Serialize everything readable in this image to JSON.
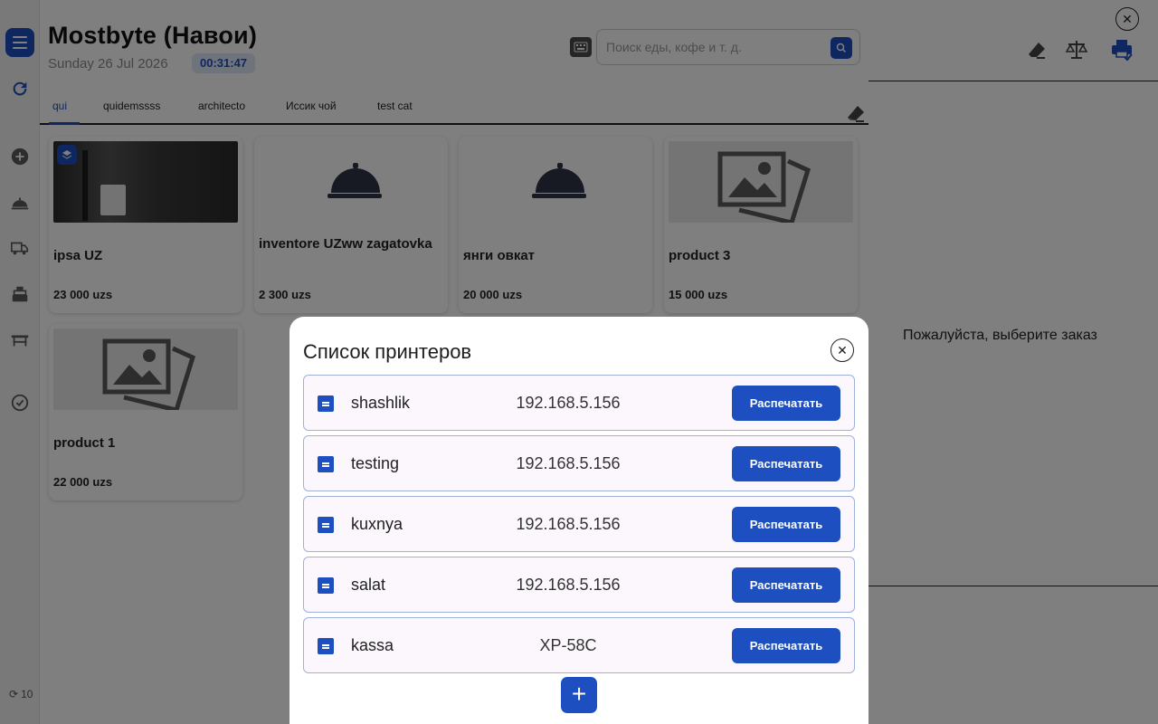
{
  "header": {
    "title": "Mostbyte (Навои)",
    "date": "Sunday 26 Jul 2026",
    "time": "00:31:47",
    "search_placeholder": "Поиск еды, кофе и т. д."
  },
  "tabs": [
    {
      "label": "qui",
      "active": true
    },
    {
      "label": "quidemssss"
    },
    {
      "label": "architecto"
    },
    {
      "label": "Иссик чой"
    },
    {
      "label": "test cat"
    }
  ],
  "products": [
    {
      "name": "ipsa UZ",
      "price": "23 000 uzs",
      "image": "photo"
    },
    {
      "name": "inventore UZww zagatovka",
      "price": "2 300 uzs",
      "image": "cloche-icon"
    },
    {
      "name": "янги овкат",
      "price": "20 000 uzs",
      "image": "cloche-icon"
    },
    {
      "name": "product 3",
      "price": "15 000 uzs",
      "image": "image-placeholder-icon"
    },
    {
      "name": "product 1",
      "price": "22 000 uzs",
      "image": "image-placeholder-icon"
    }
  ],
  "sidebar": {
    "icons": [
      "menu-icon",
      "refresh-icon",
      "add-icon",
      "cloche-icon",
      "truck-icon",
      "cash-register-icon",
      "table-icon",
      "check-circle-icon"
    ],
    "sync_count": "10"
  },
  "right_panel": {
    "empty_message": "Пожалуйста, выберите заказ",
    "icons": [
      "eraser-icon",
      "scale-icon",
      "printer-check-icon",
      "close-icon"
    ]
  },
  "modal": {
    "title": "Список принтеров",
    "print_label": "Распечатать",
    "printers": [
      {
        "name": "shashlik",
        "address": "192.168.5.156"
      },
      {
        "name": "testing",
        "address": "192.168.5.156"
      },
      {
        "name": "kuxnya",
        "address": "192.168.5.156"
      },
      {
        "name": "salat",
        "address": "192.168.5.156"
      },
      {
        "name": "kassa",
        "address": "XP-58C"
      }
    ],
    "add_label": "+"
  },
  "colors": {
    "accent": "#1d4fc1",
    "overlay": "rgba(0,0,0,0.5)",
    "printer_row_bg": "#fbf7fd"
  }
}
